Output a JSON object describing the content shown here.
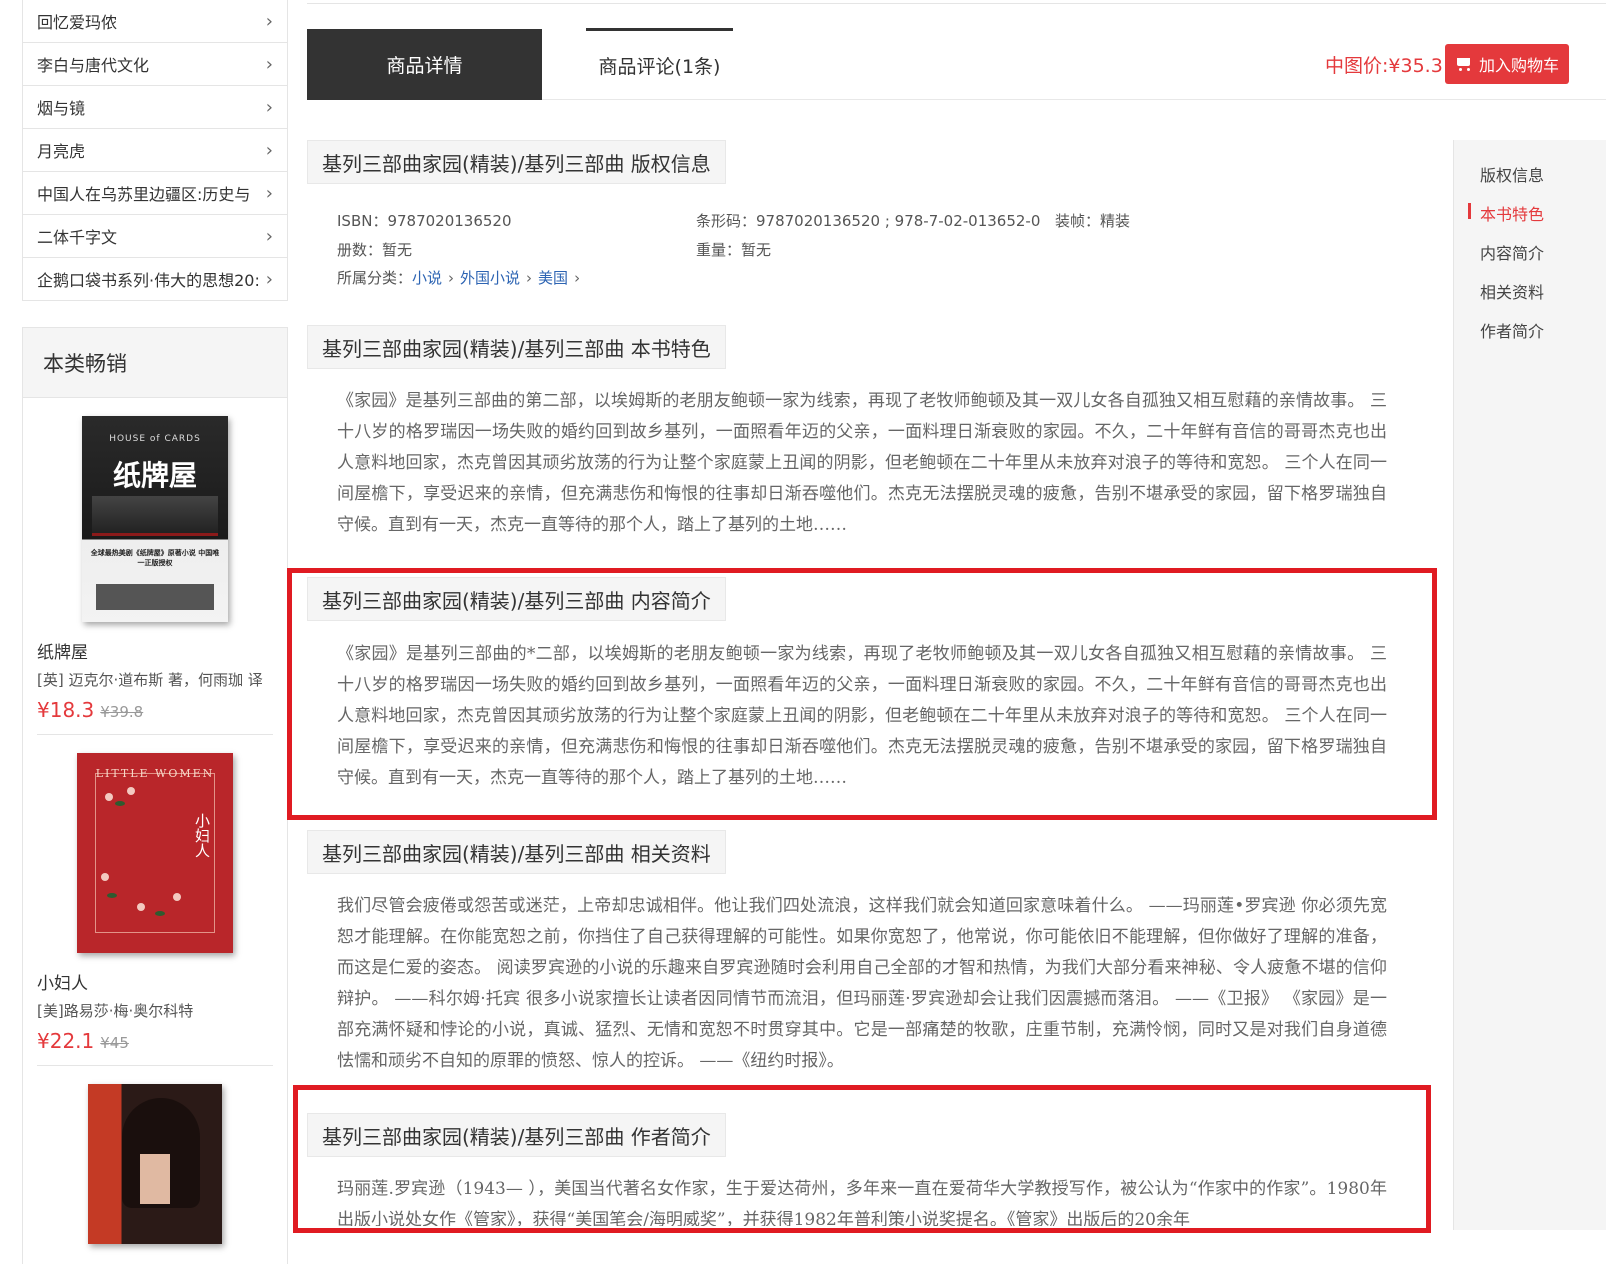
{
  "categories": [
    {
      "label": "回忆爱玛侬"
    },
    {
      "label": "李白与唐代文化"
    },
    {
      "label": "烟与镜"
    },
    {
      "label": "月亮虎"
    },
    {
      "label": "中国人在乌苏里边疆区:历史与"
    },
    {
      "label": "二体千字文"
    },
    {
      "label": "企鹅口袋书系列·伟大的思想20:"
    }
  ],
  "chevron": "›",
  "bestsellers": {
    "heading": "本类畅销",
    "items": [
      {
        "title": "纸牌屋",
        "author": "[英] 迈克尔·道布斯 著，何雨珈 译",
        "price": "¥18.3",
        "old_price": "¥39.8",
        "cover_text_top": "HOUSE of CARDS",
        "cover_title": "纸牌屋",
        "cover_blurb": "全球最热美剧《纸牌屋》原著小说 中国唯一正版授权"
      },
      {
        "title": "小妇人",
        "author": "[美]路易莎·梅·奥尔科特",
        "price": "¥22.1",
        "old_price": "¥45",
        "cover_text_top": "LITTLE WOMEN",
        "cover_title": "小妇人"
      },
      {
        "title": "",
        "author": "",
        "price": "",
        "old_price": ""
      }
    ]
  },
  "tabs": {
    "details": "商品详情",
    "reviews": "商品评论(1条)"
  },
  "price_label": "中图价:¥35.3",
  "cart_button": "加入购物车",
  "right_nav": [
    "版权信息",
    "本书特色",
    "内容简介",
    "相关资料",
    "作者简介"
  ],
  "right_nav_active": "本书特色",
  "sections": {
    "copyright": {
      "title": "基列三部曲家园(精装)/基列三部曲 版权信息",
      "isbn": "ISBN：9787020136520",
      "barcode": "条形码：9787020136520 ; 978-7-02-013652-0",
      "binding": "装帧：精装",
      "volumes": "册数：暂无",
      "weight": "重量：暂无",
      "category_label": "所属分类：",
      "category_path": [
        "小说",
        "外国小说",
        "美国"
      ]
    },
    "features": {
      "title": "基列三部曲家园(精装)/基列三部曲 本书特色",
      "text": "《家园》是基列三部曲的第二部，以埃姆斯的老朋友鲍顿一家为线索，再现了老牧师鲍顿及其一双儿女各自孤独又相互慰藉的亲情故事。 三十八岁的格罗瑞因一场失败的婚约回到故乡基列，一面照看年迈的父亲，一面料理日渐衰败的家园。不久，二十年鲜有音信的哥哥杰克也出人意料地回家，杰克曾因其顽劣放荡的行为让整个家庭蒙上丑闻的阴影，但老鲍顿在二十年里从未放弃对浪子的等待和宽恕。 三个人在同一间屋檐下，享受迟来的亲情，但充满悲伤和悔恨的往事却日渐吞噬他们。杰克无法摆脱灵魂的疲惫，告别不堪承受的家园，留下格罗瑞独自守候。直到有一天，杰克一直等待的那个人，踏上了基列的土地……"
    },
    "summary": {
      "title": "基列三部曲家园(精装)/基列三部曲 内容简介",
      "text": "《家园》是基列三部曲的*二部，以埃姆斯的老朋友鲍顿一家为线索，再现了老牧师鲍顿及其一双儿女各自孤独又相互慰藉的亲情故事。 三十八岁的格罗瑞因一场失败的婚约回到故乡基列，一面照看年迈的父亲，一面料理日渐衰败的家园。不久，二十年鲜有音信的哥哥杰克也出人意料地回家，杰克曾因其顽劣放荡的行为让整个家庭蒙上丑闻的阴影，但老鲍顿在二十年里从未放弃对浪子的等待和宽恕。 三个人在同一间屋檐下，享受迟来的亲情，但充满悲伤和悔恨的往事却日渐吞噬他们。杰克无法摆脱灵魂的疲惫，告别不堪承受的家园，留下格罗瑞独自守候。直到有一天，杰克一直等待的那个人，踏上了基列的土地……"
    },
    "related": {
      "title": "基列三部曲家园(精装)/基列三部曲 相关资料",
      "text": "我们尽管会疲倦或怨苦或迷茫，上帝却忠诚相伴。他让我们四处流浪，这样我们就会知道回家意味着什么。 ——玛丽莲•罗宾逊 你必须先宽恕才能理解。在你能宽恕之前，你挡住了自己获得理解的可能性。如果你宽恕了，他常说，你可能依旧不能理解，但你做好了理解的准备，而这是仁爱的姿态。 阅读罗宾逊的小说的乐趣来自罗宾逊随时会利用自己全部的才智和热情，为我们大部分看来神秘、令人疲惫不堪的信仰辩护。 ——科尔姆·托宾 很多小说家擅长让读者因同情节而流泪，但玛丽莲·罗宾逊却会让我们因震撼而落泪。 ——《卫报》 《家园》是一部充满怀疑和悖论的小说，真诚、猛烈、无情和宽恕不时贯穿其中。它是一部痛楚的牧歌，庄重节制，充满怜悯，同时又是对我们自身道德怯懦和顽劣不自知的原罪的愤怒、惊人的控诉。 ——《纽约时报》。"
    },
    "author": {
      "title": "基列三部曲家园(精装)/基列三部曲 作者简介",
      "text": "玛丽莲.罗宾逊（1943— ），美国当代著名女作家，生于爱达荷州，多年来一直在爱荷华大学教授写作，被公认为“作家中的作家”。1980年出版小说处女作《管家》，获得“美国笔会/海明威奖”，并获得1982年普利策小说奖提名。《管家》出版后的20余年"
    }
  },
  "colors": {
    "accent": "#e4393c",
    "highlight_box": "#e01b22",
    "tab_active_bg": "#333333",
    "link": "#2d64b3"
  }
}
